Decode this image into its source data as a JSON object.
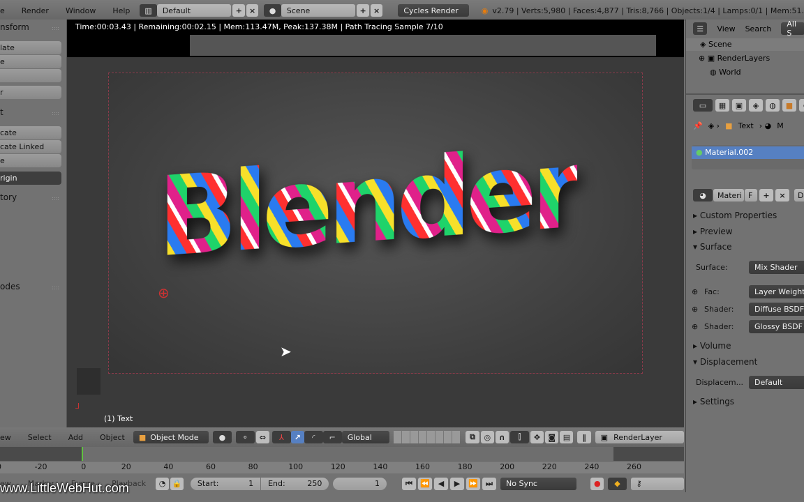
{
  "topbar": {
    "menus": [
      "e",
      "Render",
      "Window",
      "Help"
    ],
    "screen_layout": "Default",
    "scene": "Scene",
    "engine": "Cycles Render",
    "stats": "v2.79 | Verts:5,980 | Faces:4,877 | Tris:8,766 | Objects:1/4 | Lamps:0/1 | Mem:51."
  },
  "left_panel": {
    "transform_header": "nsform",
    "transform_buttons": [
      "late",
      "e",
      "",
      "r"
    ],
    "edit_header": "t",
    "edit_buttons": [
      "cate",
      "cate Linked",
      "e"
    ],
    "origin_dropdown": "rigin",
    "history_header": "tory",
    "nodes_header": "odes"
  },
  "viewport": {
    "render_status": "Time:00:03.43 | Remaining:00:02.15 | Mem:113.47M, Peak:137.38M | Path Tracing Sample 7/10",
    "object_label": "(1) Text",
    "render_text": "Blender"
  },
  "header3d": {
    "menus": [
      "ew",
      "Select",
      "Add",
      "Object"
    ],
    "mode": "Object Mode",
    "orientation": "Global",
    "render_layer": "RenderLayer"
  },
  "timeline": {
    "ticks": [
      "0",
      "-20",
      "0",
      "20",
      "40",
      "60",
      "80",
      "100",
      "120",
      "140",
      "160",
      "180",
      "200",
      "220",
      "240",
      "260"
    ],
    "menus": [
      "ew",
      "Marker",
      "Frame",
      "Playback"
    ],
    "start_label": "Start:",
    "start": "1",
    "end_label": "End:",
    "end": "250",
    "current": "1",
    "sync": "No Sync"
  },
  "outliner": {
    "view": "View",
    "search": "Search",
    "filter": "All S",
    "items": [
      "Scene",
      "RenderLayers",
      "World"
    ]
  },
  "properties": {
    "breadcrumb": [
      "Text",
      "M"
    ],
    "material_slot": "Material.002",
    "material_name": "Materi",
    "fake": "F",
    "d": "D",
    "panels": {
      "custom": "Custom Properties",
      "preview": "Preview",
      "surface": "Surface",
      "volume": "Volume",
      "displacement": "Displacement",
      "settings": "Settings"
    },
    "surface_label": "Surface:",
    "surface_value": "Mix Shader",
    "fac_label": "Fac:",
    "fac_value": "Layer Weight",
    "shader1_label": "Shader:",
    "shader1_value": "Diffuse BSDF",
    "shader2_label": "Shader:",
    "shader2_value": "Glossy BSDF",
    "disp_label": "Displacem...",
    "disp_value": "Default"
  },
  "watermark": "www.LittleWebHut.com",
  "colors": {
    "selection": "#5680c2",
    "playhead": "#60c040"
  }
}
